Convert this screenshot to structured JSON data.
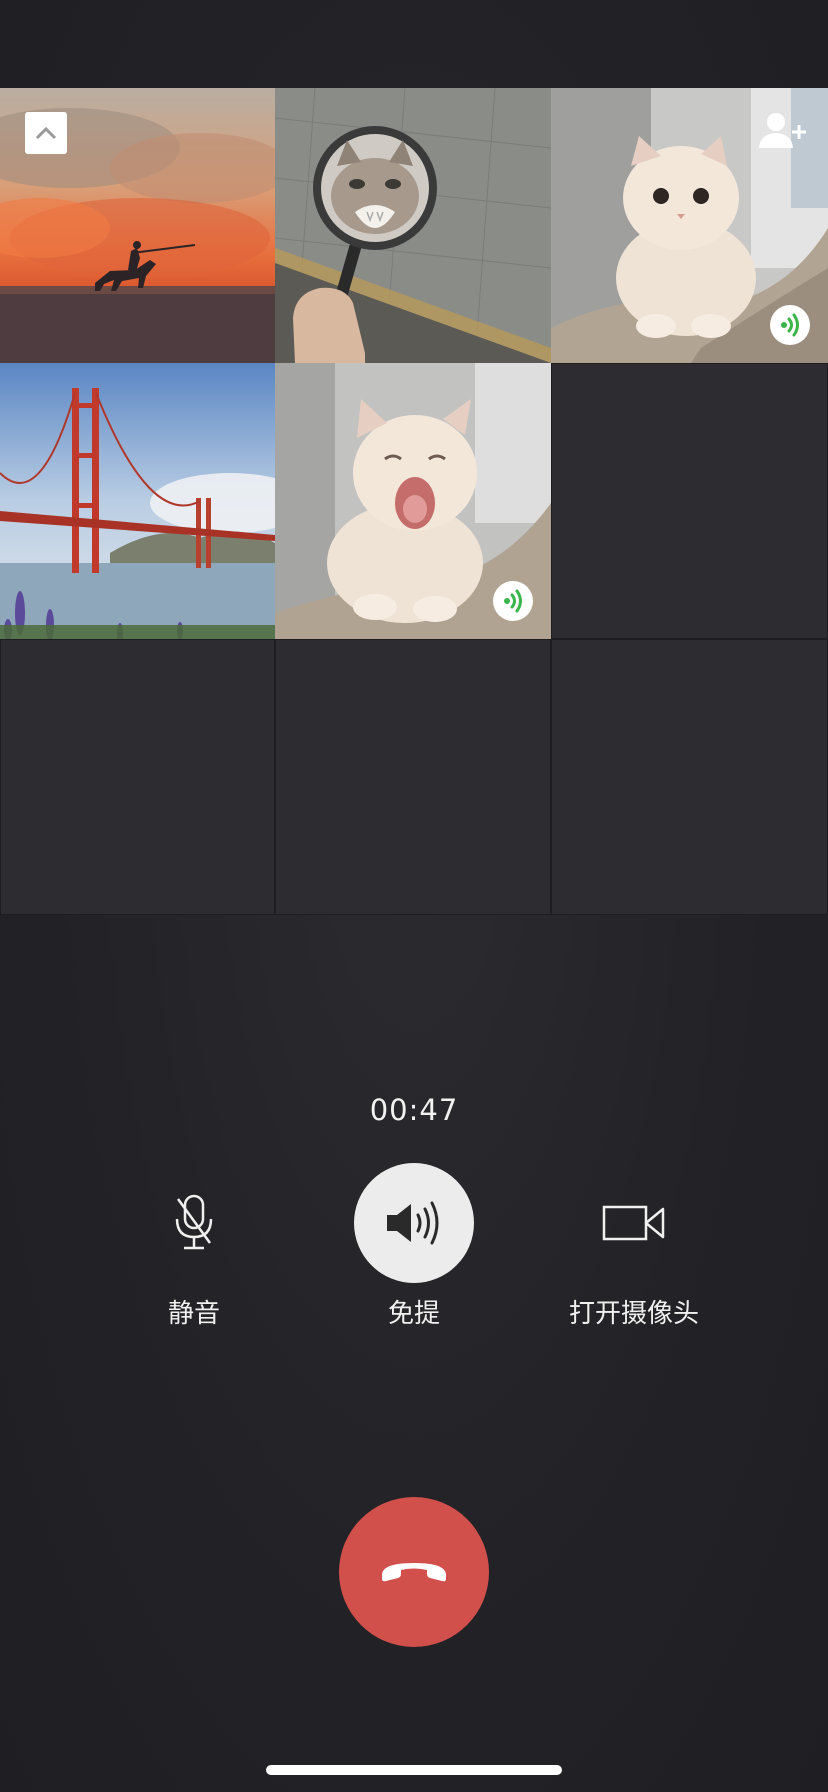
{
  "call": {
    "timer": "00:47"
  },
  "participants": [
    {
      "scene": "desert-rider-painting",
      "speaking": false
    },
    {
      "scene": "cat-under-magnifying-glass",
      "speaking": false
    },
    {
      "scene": "cream-cat-sitting",
      "speaking": true
    },
    {
      "scene": "golden-gate-bridge",
      "speaking": false
    },
    {
      "scene": "cream-cat-yawning",
      "speaking": true
    },
    {
      "scene": "empty-slot",
      "speaking": false
    },
    {
      "scene": "empty-slot",
      "speaking": false
    },
    {
      "scene": "empty-slot",
      "speaking": false
    },
    {
      "scene": "empty-slot",
      "speaking": false
    }
  ],
  "controls": {
    "mute": {
      "label": "静音",
      "icon": "microphone-muted-icon",
      "active": false
    },
    "speaker": {
      "label": "免提",
      "icon": "speaker-icon",
      "active": true
    },
    "camera": {
      "label": "打开摄像头",
      "icon": "camera-icon",
      "active": false
    }
  },
  "icons": {
    "collapse": "chevron-up-icon",
    "add_member": "add-person-icon",
    "speaking": "speaking-indicator-icon",
    "hangup": "hang-up-icon"
  },
  "colors": {
    "background": "#232327",
    "hangup": "#d2504c",
    "speaking_green": "#3bb54a",
    "active_control": "#ececec"
  }
}
